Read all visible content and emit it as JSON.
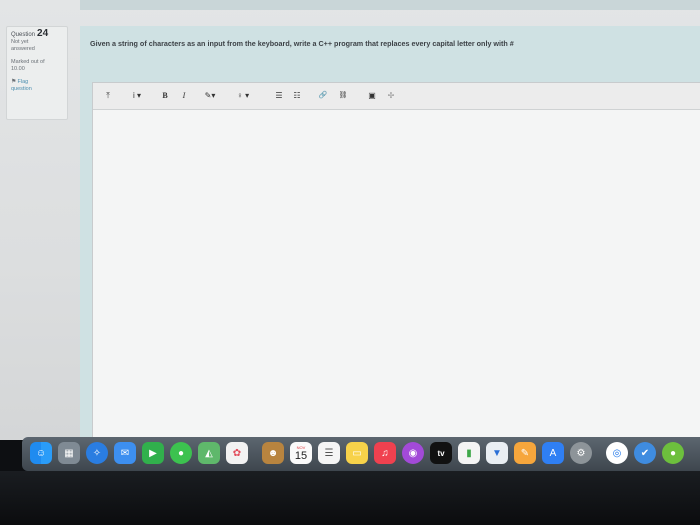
{
  "question": {
    "label": "Question",
    "number": "24",
    "status_line1": "Not yet",
    "status_line2": "answered",
    "marked_line1": "Marked out of",
    "marked_line2": "10.00",
    "flag_line1": "Flag",
    "flag_line2": "question",
    "text": "Given a string of characters as an input from the keyboard, write a C++ program that replaces every capital letter only with #"
  },
  "toolbar": {
    "collapse": "⤒",
    "info": "i ▾",
    "bold": "B",
    "italic": "I",
    "brush": "✎▾",
    "style": "♀ ▾",
    "ulist": "☰",
    "olist": "☷",
    "link": "🔗",
    "unlink": "⛓",
    "image": "▣",
    "media": "✢"
  },
  "dock": {
    "calendar_month": "NOV",
    "calendar_day": "15",
    "tv_label": "tv"
  }
}
